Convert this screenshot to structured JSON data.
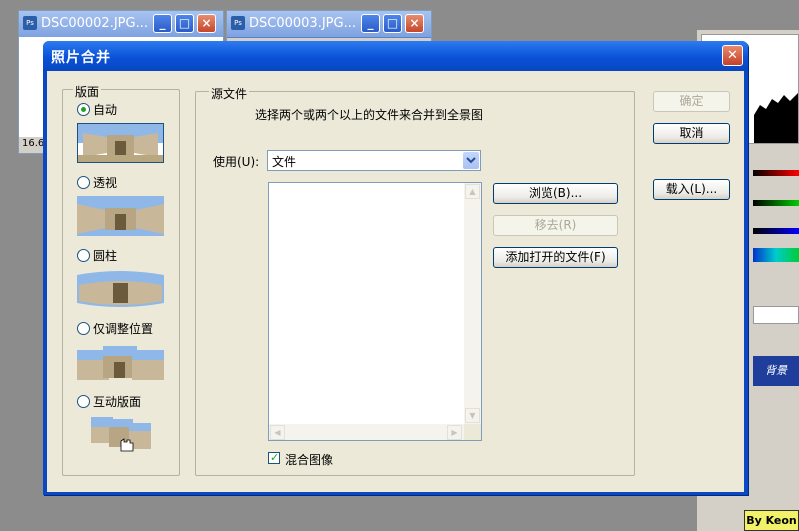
{
  "background_windows": [
    {
      "title": "DSC00002.JPG...",
      "zoom": "16.6"
    },
    {
      "title": "DSC00003.JPG..."
    }
  ],
  "right_panel": {
    "layer_label": "背景"
  },
  "dialog": {
    "title": "照片合并",
    "layout_group": {
      "label": "版面",
      "options": [
        {
          "label": "自动",
          "selected": true
        },
        {
          "label": "透视",
          "selected": false
        },
        {
          "label": "圆柱",
          "selected": false
        },
        {
          "label": "仅调整位置",
          "selected": false
        },
        {
          "label": "互动版面",
          "selected": false
        }
      ]
    },
    "source_group": {
      "label": "源文件",
      "description": "选择两个或两个以上的文件来合并到全景图",
      "use_label": "使用(U):",
      "use_value": "文件",
      "browse_label": "浏览(B)...",
      "remove_label": "移去(R)",
      "add_open_label": "添加打开的文件(F)",
      "blend_label": "混合图像",
      "blend_checked": true
    },
    "ok_label": "确定",
    "cancel_label": "取消",
    "load_label": "载入(L)..."
  },
  "watermark": "By Keon",
  "colors": {
    "title_blue": "#0a52d8",
    "dialog_bg": "#ece9d8",
    "accent_green": "#21a121"
  }
}
